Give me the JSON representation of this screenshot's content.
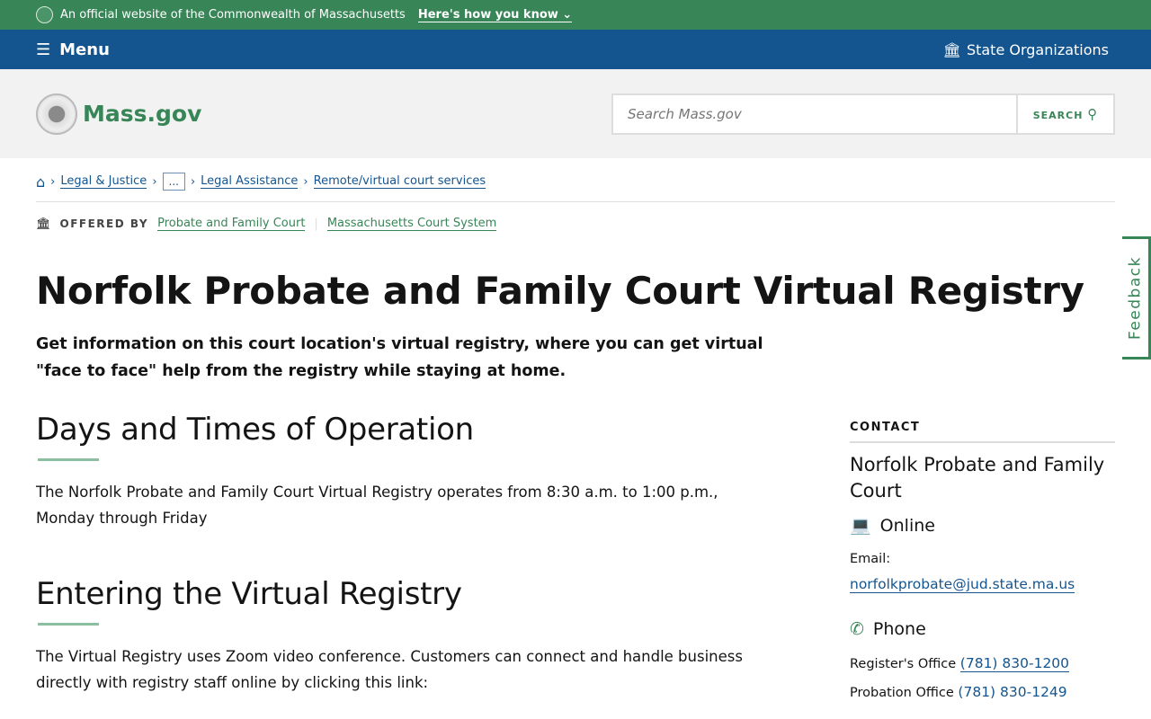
{
  "banner": {
    "text": "An official website of the Commonwealth of Massachusetts",
    "how": "Here's how you know"
  },
  "nav": {
    "menu": "Menu",
    "orgs": "State Organizations"
  },
  "header": {
    "logo": "Mass.gov",
    "search_placeholder": "Search Mass.gov",
    "search_button": "SEARCH"
  },
  "breadcrumbs": [
    "Legal & Justice",
    "...",
    "Legal Assistance",
    "Remote/virtual court services"
  ],
  "offered": {
    "label": "OFFERED BY",
    "orgs": [
      "Probate and Family Court",
      "Massachusetts Court System"
    ]
  },
  "page": {
    "title": "Norfolk Probate and Family Court Virtual Registry",
    "lede": "Get information on this court location's virtual registry, where you can get virtual \"face to face\" help from the registry while staying at home."
  },
  "sections": [
    {
      "heading": "Days and Times of Operation",
      "body": "The Norfolk Probate and Family Court Virtual Registry operates from 8:30 a.m. to 1:00 p.m., Monday through Friday"
    },
    {
      "heading": "Entering the Virtual Registry",
      "body": "The Virtual Registry uses Zoom video conference. Customers can connect and handle business directly with registry staff online by clicking this link:"
    }
  ],
  "contact": {
    "label": "CONTACT",
    "org": "Norfolk Probate and Family Court",
    "online": "Online",
    "email_label": "Email:",
    "email": "norfolkprobate@jud.state.ma.us",
    "phone": "Phone",
    "register_label": "Register's Office",
    "register": "(781) 830-1200",
    "probation_label": "Probation Office",
    "probation": "(781) 830-1249"
  },
  "feedback": "Feedback"
}
